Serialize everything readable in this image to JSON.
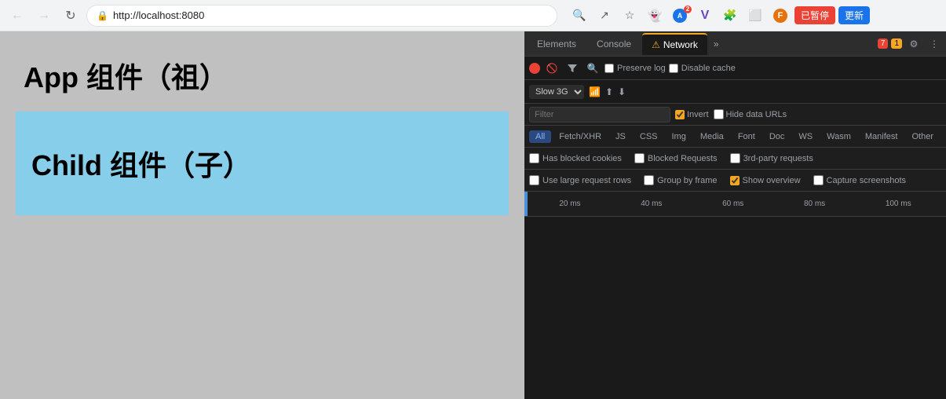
{
  "browser": {
    "url": "http://localhost:8080",
    "back_disabled": true,
    "forward_disabled": true
  },
  "page": {
    "app_title": "App 组件（祖）",
    "child_title": "Child 组件（子）"
  },
  "devtools": {
    "tabs": [
      {
        "id": "elements",
        "label": "Elements",
        "active": false
      },
      {
        "id": "console",
        "label": "Console",
        "active": false
      },
      {
        "id": "network",
        "label": "Network",
        "active": true
      },
      {
        "id": "more",
        "label": "»",
        "active": false
      }
    ],
    "badges": {
      "errors": "7",
      "warnings": "1"
    },
    "network": {
      "preserve_log_label": "Preserve log",
      "disable_cache_label": "Disable cache",
      "throttle_value": "Slow 3G",
      "filter_placeholder": "Filter",
      "invert_label": "Invert",
      "hide_data_urls_label": "Hide data URLs",
      "type_filters": [
        "All",
        "Fetch/XHR",
        "JS",
        "CSS",
        "Img",
        "Media",
        "Font",
        "Doc",
        "WS",
        "Wasm",
        "Manifest",
        "Other"
      ],
      "active_type_filter": "All",
      "has_blocked_cookies_label": "Has blocked cookies",
      "blocked_requests_label": "Blocked Requests",
      "third_party_requests_label": "3rd-party requests",
      "use_large_rows_label": "Use large request rows",
      "group_by_frame_label": "Group by frame",
      "show_overview_label": "Show overview",
      "capture_screenshots_label": "Capture screenshots",
      "timeline_ticks": [
        "20 ms",
        "40 ms",
        "60 ms",
        "80 ms",
        "100 ms"
      ]
    }
  },
  "toolbar_buttons": {
    "pause_label": "已暂停",
    "update_label": "更新"
  }
}
